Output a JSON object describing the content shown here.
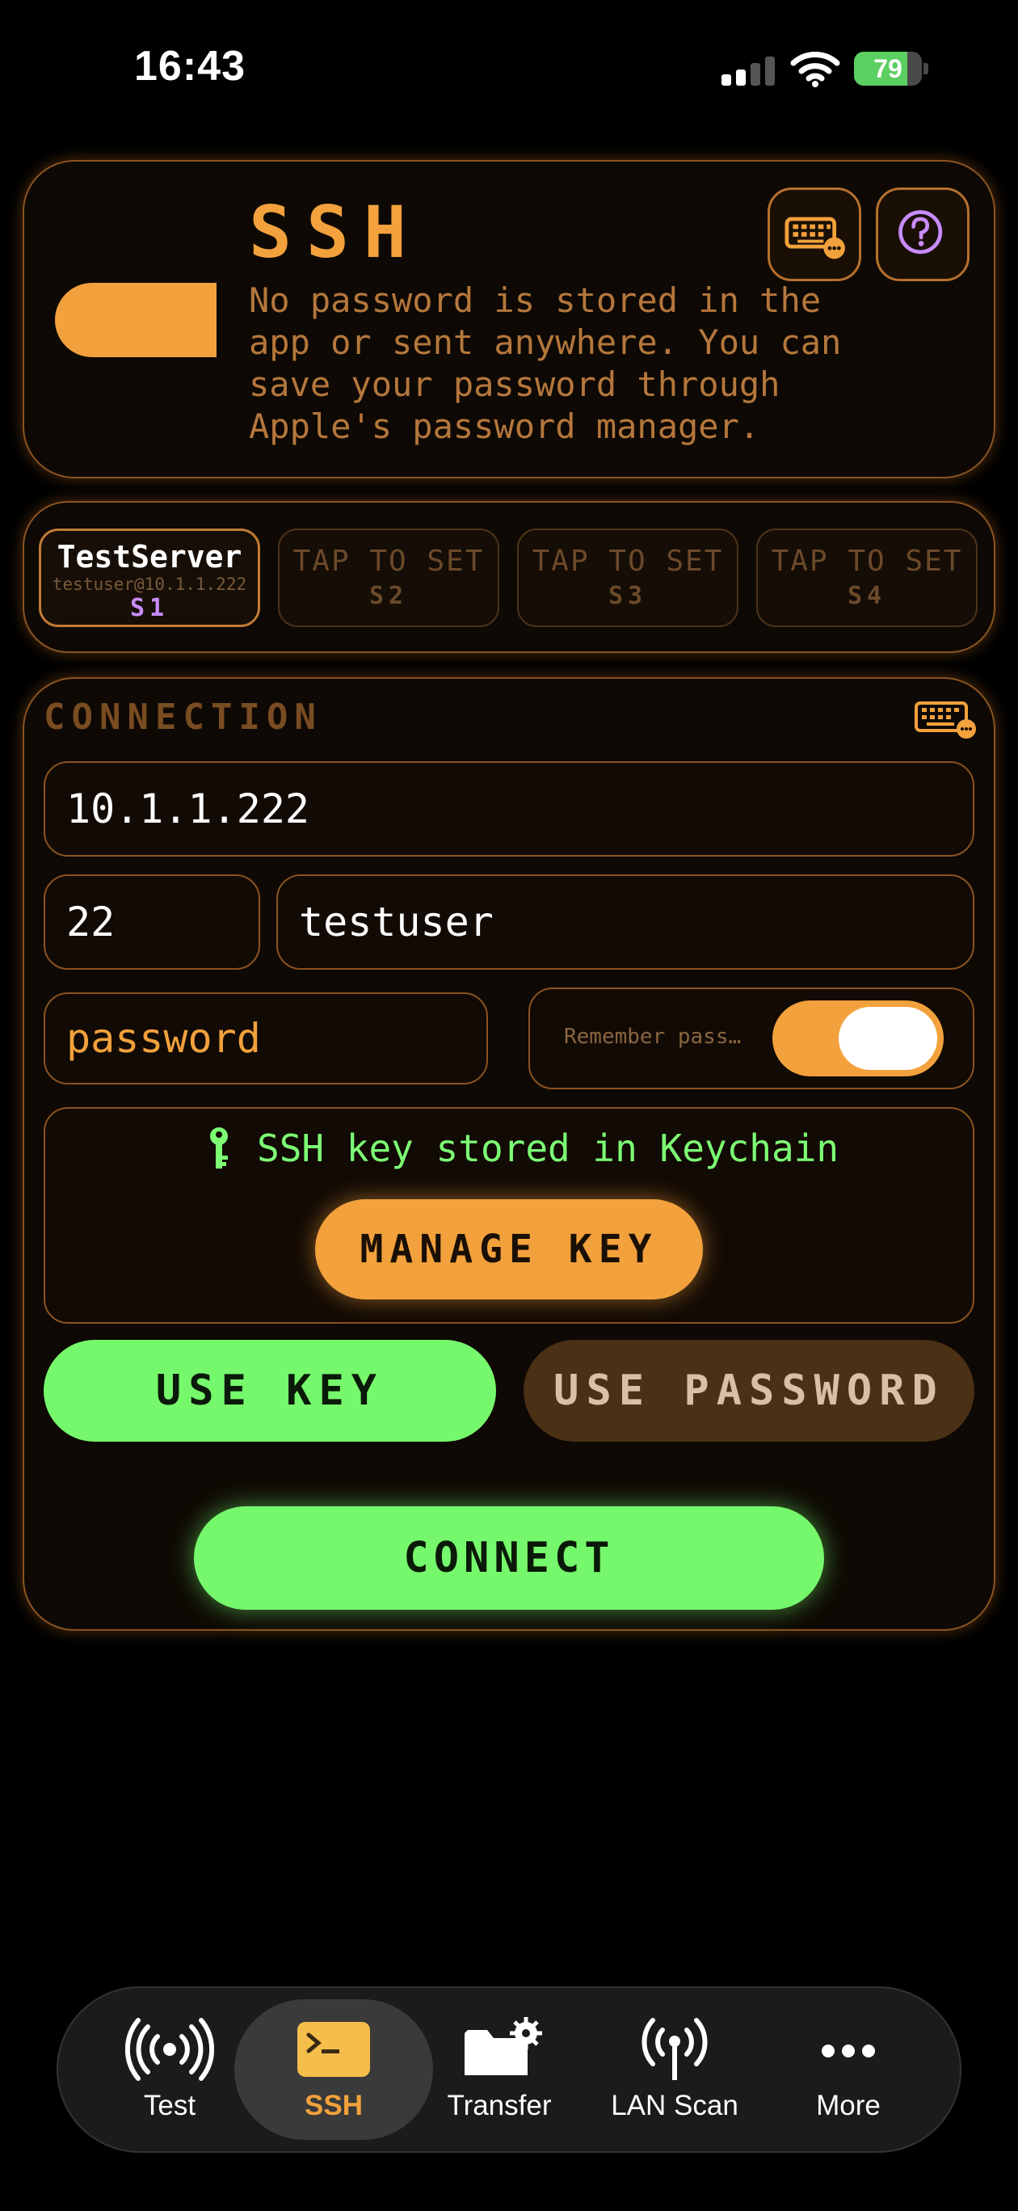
{
  "status_bar": {
    "time": "16:43",
    "battery": "79",
    "battery_level": 0.79
  },
  "header": {
    "title": "SSH",
    "description": "No password is stored in the app or sent anywhere. You can save your password through Apple's password manager."
  },
  "slots": [
    {
      "name": "TestServer",
      "subtitle": "testuser@10.1.1.222",
      "id": "S1"
    },
    {
      "name": "TAP TO SET",
      "id": "S2"
    },
    {
      "name": "TAP TO SET",
      "id": "S3"
    },
    {
      "name": "TAP TO SET",
      "id": "S4"
    }
  ],
  "connection": {
    "label": "CONNECTION",
    "host": "10.1.1.222",
    "port": "22",
    "username": "testuser",
    "password_placeholder": "password",
    "remember_label": "Remember pass…",
    "remember_on": true,
    "key_status": "SSH key stored in Keychain",
    "manage_key": "MANAGE KEY",
    "use_key": "USE KEY",
    "use_password": "USE PASSWORD",
    "connect": "CONNECT"
  },
  "tabs": [
    {
      "label": "Test",
      "icon": "antenna-broadcast-icon"
    },
    {
      "label": "SSH",
      "icon": "terminal-icon",
      "active": true
    },
    {
      "label": "Transfer",
      "icon": "folder-gear-icon"
    },
    {
      "label": "LAN Scan",
      "icon": "antenna-icon"
    },
    {
      "label": "More",
      "icon": "ellipsis-icon"
    }
  ],
  "colors": {
    "accent": "#f2a13c",
    "green": "#76f86c",
    "purple": "#c98cff"
  }
}
